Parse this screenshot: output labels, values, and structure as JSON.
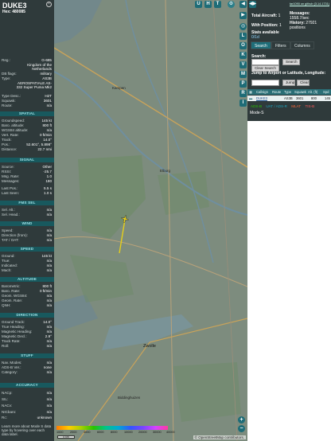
{
  "aircraft": {
    "callsign": "DUKE3",
    "hex_label": "Hex:",
    "hex": "480085",
    "fields": [
      {
        "k": "Reg.:",
        "v": "G-685"
      },
      {
        "k": "",
        "v": "Kingdom of the Netherlands"
      },
      {
        "k": "DB flags:",
        "v": "military"
      },
      {
        "k": "Type:",
        "v": "AS3B"
      },
      {
        "k": "",
        "v": "AEROSPATIALE AS-332 Super Puma Mk2"
      },
      {
        "k": "Type Desc.:",
        "v": "H2T"
      },
      {
        "k": "Squawk:",
        "v": "3601"
      },
      {
        "k": "Route:",
        "v": "n/a"
      }
    ]
  },
  "sections": {
    "spatial": {
      "title": "SPATIAL",
      "rows": [
        {
          "k": "Groundspeed:",
          "v": "145 kt"
        },
        {
          "k": "Baro. altitude:",
          "v": "800 ft"
        },
        {
          "k": "WGS84 altitude:",
          "v": "n/a"
        },
        {
          "k": "Vert. Rate:",
          "v": "0 ft/min"
        },
        {
          "k": "Track:",
          "v": "14.0°"
        },
        {
          "k": "Pos.:",
          "v": "52.601°, 5.898°"
        },
        {
          "k": "Distance:",
          "v": "22.7 nmi"
        }
      ]
    },
    "signal": {
      "title": "SIGNAL",
      "rows": [
        {
          "k": "Source:",
          "v": "Other"
        },
        {
          "k": "RSSI:",
          "v": "-25.7"
        },
        {
          "k": "Msg. Rate:",
          "v": "1.0"
        },
        {
          "k": "Messages:",
          "v": "180"
        },
        {
          "k": "Last Pos.:",
          "v": "5.5 s"
        },
        {
          "k": "Last Seen:",
          "v": "1.0 s"
        }
      ]
    },
    "fms": {
      "title": "FMS SEL",
      "rows": [
        {
          "k": "Sel. Alt.:",
          "v": "n/a"
        },
        {
          "k": "Sel. Head.:",
          "v": "n/a"
        }
      ]
    },
    "wind": {
      "title": "WIND",
      "rows": [
        {
          "k": "Speed:",
          "v": "n/a"
        },
        {
          "k": "Direction (from):",
          "v": "n/a"
        },
        {
          "k": "TAT / OAT:",
          "v": "n/a"
        }
      ]
    },
    "speed": {
      "title": "SPEED",
      "rows": [
        {
          "k": "Ground:",
          "v": "145 kt"
        },
        {
          "k": "True:",
          "v": "n/a"
        },
        {
          "k": "Indicated:",
          "v": "n/a"
        },
        {
          "k": "Mach:",
          "v": "n/a"
        }
      ]
    },
    "altitude": {
      "title": "ALTITUDE",
      "rows": [
        {
          "k": "Barometric:",
          "v": "800 ft"
        },
        {
          "k": "Baro. Rate:",
          "v": "0 ft/min"
        },
        {
          "k": "Geom. WGS84:",
          "v": "n/a"
        },
        {
          "k": "Geom. Rate:",
          "v": "n/a"
        },
        {
          "k": "QNH:",
          "v": "n/a"
        }
      ]
    },
    "direction": {
      "title": "DIRECTION",
      "rows": [
        {
          "k": "Ground Track:",
          "v": "14.0°"
        },
        {
          "k": "True Heading:",
          "v": "n/a"
        },
        {
          "k": "Magnetic Heading:",
          "v": "n/a"
        },
        {
          "k": "Magnetic Decl.:",
          "v": "2.9°"
        },
        {
          "k": "Track Rate:",
          "v": "n/a"
        },
        {
          "k": "Roll:",
          "v": "n/a"
        }
      ]
    },
    "stuff": {
      "title": "STUFF",
      "rows": [
        {
          "k": "Nav. Modes:",
          "v": "n/a"
        },
        {
          "k": "ADS-B Ver.:",
          "v": "none"
        },
        {
          "k": "Category:",
          "v": "n/a"
        }
      ]
    },
    "accuracy": {
      "title": "ACCURACY",
      "rows": [
        {
          "k": "NACp:",
          "v": "n/a"
        },
        {
          "k": "SIL:",
          "v": "n/a"
        },
        {
          "k": "NACv:",
          "v": "n/a"
        },
        {
          "k": "NICbaro:",
          "v": "n/a"
        },
        {
          "k": "Rc:",
          "v": "unknown"
        }
      ]
    },
    "learn_more": "Learn more about Mode S data type by hovering over each data label."
  },
  "map": {
    "top_buttons": [
      "U",
      "H",
      "T"
    ],
    "side_buttons": [
      "I",
      "L",
      "O",
      "K",
      "V",
      "M",
      "P",
      "R"
    ],
    "places": [
      {
        "name": "Kampen",
        "id": "kampen"
      },
      {
        "name": "Emmeloord",
        "id": "emmeloord"
      },
      {
        "name": "Zwolle",
        "id": "zwolle"
      },
      {
        "name": "Biddinghuizen",
        "id": "biddinghuizen"
      },
      {
        "name": "Dronten",
        "id": "dronten"
      },
      {
        "name": "Elburg",
        "id": "elburg"
      },
      {
        "name": "Wijhe",
        "id": "wijhe"
      }
    ],
    "attribution": "© OpenStreetMap contributors.",
    "altitude_scale": [
      "1000",
      "2000",
      "4000",
      "6000",
      "8000",
      "10000",
      "20000",
      "30000",
      "40000"
    ],
    "scale_label": "5 km",
    "zoom_in": "+",
    "zoom_out": "−"
  },
  "right": {
    "github_link": "tar1090 on github (3.14.1731)",
    "total_label": "Total Aircraft:",
    "total": "1",
    "with_pos_label": "With Position:",
    "with_pos": "1",
    "stats_label": "Stats available",
    "stats_value": "0/1d",
    "messages_label": "Messages:",
    "messages": "1558.7/sec",
    "history_label": "History:",
    "history": "27921 positions",
    "tabs": [
      "Search",
      "Filters",
      "Columns"
    ],
    "search_label": "Search:",
    "search_btn": "Search",
    "clear_search_btn": "Clear Search",
    "jump_label": "Jump to Airport or Latitude, Longitude:",
    "jump_btn": "Jump",
    "clear_btn": "Clear",
    "table_headers": [
      "Type",
      "Callsign",
      "Route",
      "Type",
      "Squawk",
      "Alt. (ft)",
      "Spd"
    ],
    "table_row": {
      "callsign": "DUKE3",
      "route": "",
      "type": "AS3B",
      "squawk": "3601",
      "alt": "800",
      "spd": "145"
    },
    "badges": [
      {
        "label": "ADS-B",
        "color": "#27c400"
      },
      {
        "label": "UAT / ADS-R",
        "color": "#1ea7c0"
      },
      {
        "label": "MLAT",
        "color": "#ff6a3a"
      },
      {
        "label": "TIS-B",
        "color": "#ff5a5a"
      }
    ],
    "modes": "Mode-S"
  },
  "colors": {
    "accent": "#1e6c77",
    "panel": "#2f3a3b",
    "section": "#18595e"
  }
}
